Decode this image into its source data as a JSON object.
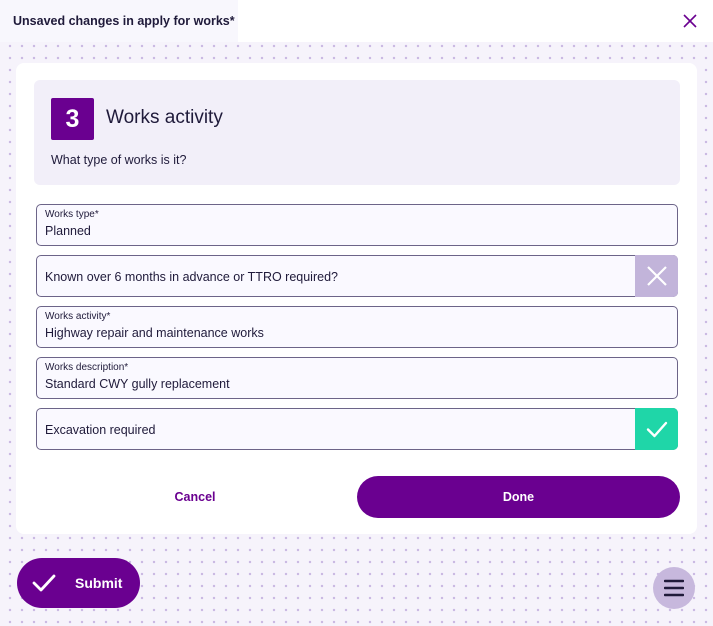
{
  "header": {
    "title": "Unsaved changes in apply for works*",
    "close_icon": "close-icon"
  },
  "step": {
    "number": "3",
    "title": "Works activity",
    "question": "What type of works is it?"
  },
  "fields": {
    "works_type": {
      "label": "Works type*",
      "value": "Planned"
    },
    "advance_notice": {
      "label": "Known over 6 months in advance or TTRO required?",
      "checked": false,
      "icon": "cross-icon"
    },
    "works_activity": {
      "label": "Works activity*",
      "value": "Highway repair and maintenance works"
    },
    "works_description": {
      "label": "Works description*",
      "value": "Standard CWY gully replacement"
    },
    "excavation": {
      "label": "Excavation required",
      "checked": true,
      "icon": "check-icon"
    }
  },
  "actions": {
    "cancel_label": "Cancel",
    "done_label": "Done",
    "submit_label": "Submit",
    "menu_icon": "hamburger-menu-icon"
  },
  "colors": {
    "brand": "#6a0090",
    "toggle_off": "#c2b4da",
    "toggle_on": "#1fd6a8",
    "panel": "#f2eff9"
  }
}
